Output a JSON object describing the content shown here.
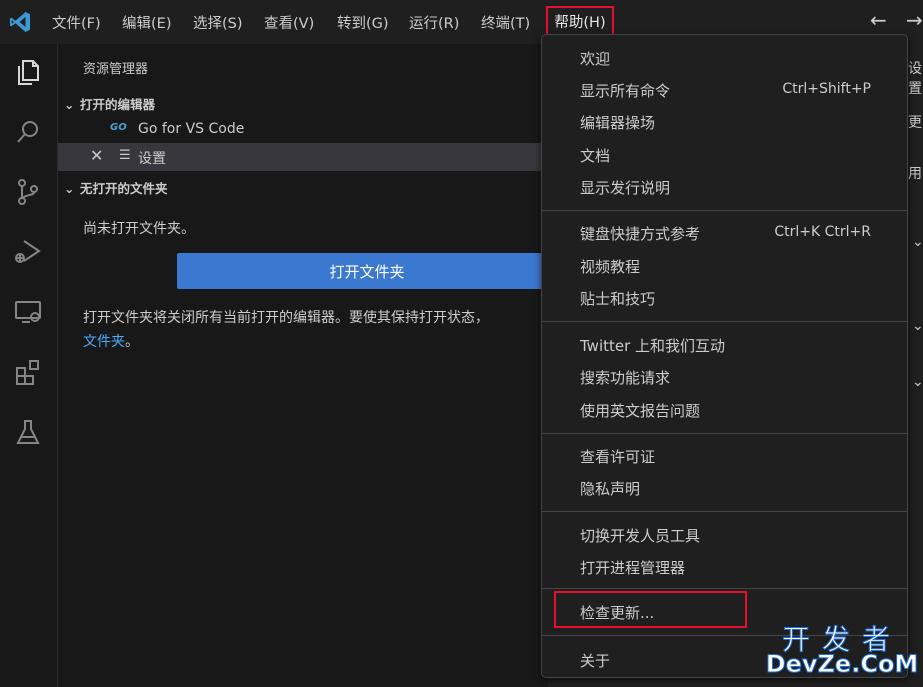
{
  "menubar": {
    "items": [
      "文件(F)",
      "编辑(E)",
      "选择(S)",
      "查看(V)",
      "转到(G)",
      "运行(R)",
      "终端(T)",
      "帮助(H)"
    ],
    "back_arrow": "←",
    "forward_arrow": "→"
  },
  "activitybar": {
    "icons": [
      "explorer-icon",
      "search-icon",
      "source-control-icon",
      "run-debug-icon",
      "remote-explorer-icon",
      "extensions-icon",
      "testing-icon"
    ]
  },
  "sidebar": {
    "title": "资源管理器",
    "open_editors": {
      "header": "打开的编辑器",
      "items": [
        {
          "icon": "GO",
          "label": "Go for VS Code"
        },
        {
          "close": "✕",
          "label": "设置"
        }
      ]
    },
    "no_folder": {
      "header": "无打开的文件夹",
      "message": "尚未打开文件夹。",
      "button": "打开文件夹",
      "hint_line1": "打开文件夹将关闭所有当前打开的编辑器。要使其保持打开状态，",
      "hint_link": "文件夹",
      "hint_end": "。"
    }
  },
  "editor_fragments": {
    "frag1": "设置",
    "frag2": "更",
    "frag3": "用",
    "chevron": "⌄"
  },
  "help_menu": {
    "items": [
      {
        "label": "欢迎",
        "key": ""
      },
      {
        "label": "显示所有命令",
        "key": "Ctrl+Shift+P"
      },
      {
        "label": "编辑器操场",
        "key": ""
      },
      {
        "label": "文档",
        "key": ""
      },
      {
        "label": "显示发行说明",
        "key": ""
      },
      {
        "label": "键盘快捷方式参考",
        "key": "Ctrl+K Ctrl+R"
      },
      {
        "label": "视频教程",
        "key": ""
      },
      {
        "label": "贴士和技巧",
        "key": ""
      },
      {
        "label": "Twitter 上和我们互动",
        "key": ""
      },
      {
        "label": "搜索功能请求",
        "key": ""
      },
      {
        "label": "使用英文报告问题",
        "key": ""
      },
      {
        "label": "查看许可证",
        "key": ""
      },
      {
        "label": "隐私声明",
        "key": ""
      },
      {
        "label": "切换开发人员工具",
        "key": ""
      },
      {
        "label": "打开进程管理器",
        "key": ""
      },
      {
        "label": "检查更新...",
        "key": ""
      },
      {
        "label": "关于",
        "key": ""
      }
    ]
  },
  "watermark": {
    "line1": "开发者",
    "line2": "DevZe.CoM"
  },
  "colors": {
    "accent": "#3b78d0",
    "highlight": "#e8112d",
    "link": "#4daafc"
  }
}
